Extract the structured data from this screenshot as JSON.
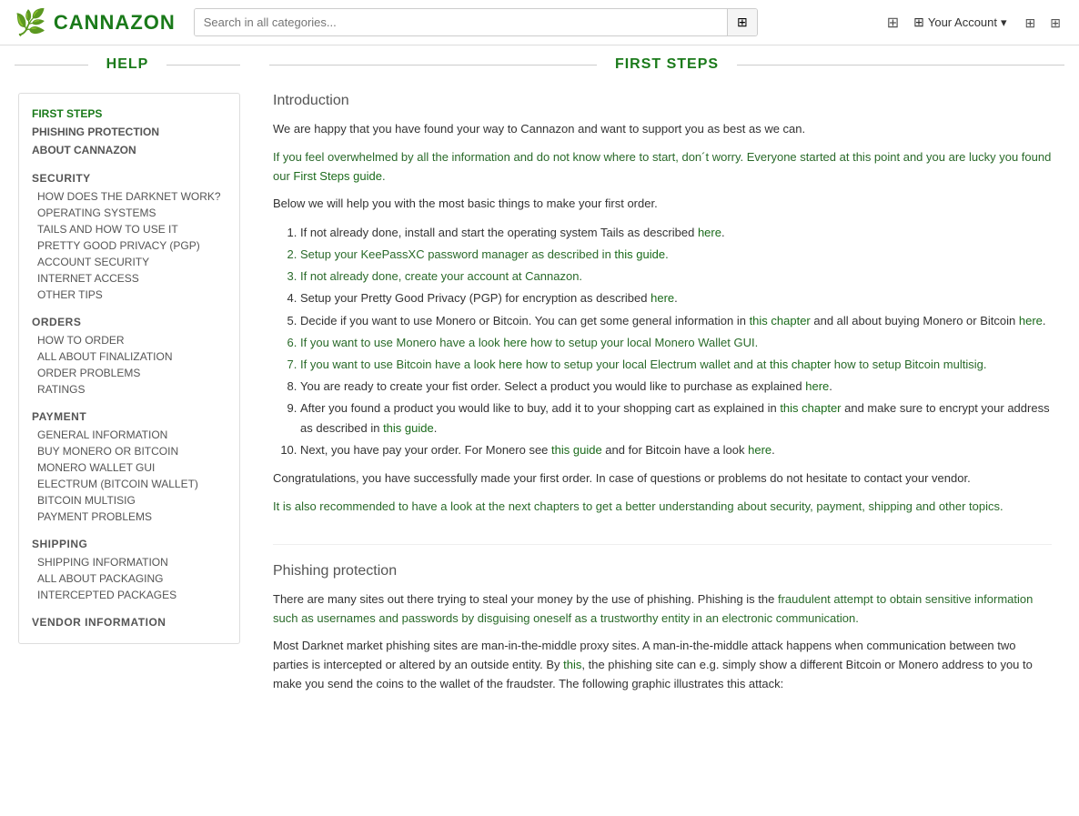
{
  "header": {
    "logo_text": "CANNAZON",
    "search_placeholder": "Search in all categories...",
    "account_label": "Your Account"
  },
  "help_section": {
    "title": "HELP"
  },
  "main_section": {
    "title": "FIRST STEPS"
  },
  "sidebar": {
    "top_items": [
      {
        "id": "first-steps",
        "label": "FIRST STEPS",
        "active": true
      },
      {
        "id": "phishing-protection",
        "label": "PHISHING PROTECTION",
        "active": false
      },
      {
        "id": "about-cannazon",
        "label": "ABOUT CANNAZON",
        "active": false
      }
    ],
    "sections": [
      {
        "label": "SECURITY",
        "items": [
          "HOW DOES THE DARKNET WORK?",
          "OPERATING SYSTEMS",
          "TAILS AND HOW TO USE IT",
          "PRETTY GOOD PRIVACY (PGP)",
          "ACCOUNT SECURITY",
          "INTERNET ACCESS",
          "OTHER TIPS"
        ]
      },
      {
        "label": "ORDERS",
        "items": [
          "HOW TO ORDER",
          "ALL ABOUT FINALIZATION",
          "ORDER PROBLEMS",
          "RATINGS"
        ]
      },
      {
        "label": "PAYMENT",
        "items": [
          "GENERAL INFORMATION",
          "BUY MONERO OR BITCOIN",
          "MONERO WALLET GUI",
          "ELECTRUM (BITCOIN WALLET)",
          "BITCOIN MULTISIG",
          "PAYMENT PROBLEMS"
        ]
      },
      {
        "label": "SHIPPING",
        "items": [
          "SHIPPING INFORMATION",
          "ALL ABOUT PACKAGING",
          "INTERCEPTED PACKAGES"
        ]
      },
      {
        "label": "VENDOR INFORMATION",
        "items": []
      }
    ]
  },
  "main_content": {
    "intro_heading": "Introduction",
    "intro_para1": "We are happy that you have found your way to Cannazon and want to support you as best as we can.",
    "intro_para2_pre": "If you feel overwhelmed by all the information and do not know where to start, don´t worry. Everyone started at this point and you are lucky you found our ",
    "intro_para2_link": "First Steps guide",
    "intro_para2_post": ".",
    "intro_para3": "Below we will help you with the most basic things to make your first order.",
    "steps": [
      {
        "text_pre": "If not already done, install and start the operating system Tails as described ",
        "link_text": "here",
        "text_post": ".",
        "green": false
      },
      {
        "text_pre": "Setup your KeePassXC password manager as described in ",
        "link_text": "this guide",
        "text_post": ".",
        "green": true
      },
      {
        "text_pre": "If not already done, create your account at Cannazon.",
        "link_text": "",
        "text_post": "",
        "green": true
      },
      {
        "text_pre": "Setup your Pretty Good Privacy (PGP) for encryption as described ",
        "link_text": "here",
        "text_post": ".",
        "green": false
      },
      {
        "text_pre": "Decide if you want to use Monero or Bitcoin. You can get some general information in ",
        "link_text": "this chapter",
        "text_post_pre": " and all about buying Monero or Bitcoin ",
        "link_text2": "here",
        "text_post": ".",
        "green": false
      },
      {
        "text_pre": "If you want to use Monero have a look ",
        "link_text": "here",
        "text_post": " how to setup your local Monero Wallet GUI.",
        "green": true
      },
      {
        "text_pre": "If you want to use Bitcoin have a look ",
        "link_text": "here",
        "text_post_pre": " how to setup your local Electrum wallet and at ",
        "link_text2": "this chapter",
        "text_post": " how to setup Bitcoin multisig.",
        "green": true
      },
      {
        "text_pre": "You are ready to create your fist order. Select a product you would like to purchase as explained ",
        "link_text": "here",
        "text_post": ".",
        "green": false
      },
      {
        "text_pre": "After you found a product you would like to buy, add it to your shopping cart as explained in ",
        "link_text": "this chapter",
        "text_post_pre": " and make sure to encrypt your address as described in ",
        "link_text2": "this guide",
        "text_post": ".",
        "green": false
      },
      {
        "text_pre": "Next, you have pay your order. For Monero see ",
        "link_text": "this guide",
        "text_post_pre": " and for Bitcoin have a look ",
        "link_text2": "here",
        "text_post": ".",
        "green": false
      }
    ],
    "congrats_para": "Congratulations, you have successfully made your first order. In case of questions or problems do not hesitate to contact your vendor.",
    "recommend_para": "It is also recommended to have a look at the next chapters to get a better understanding about security, payment, shipping and other topics.",
    "phishing_heading": "Phishing protection",
    "phishing_para1": "There are many sites out there trying to steal your money by the use of phishing. Phishing is the fraudulent attempt to obtain sensitive information such as usernames and passwords by disguising oneself as a trustworthy entity in an electronic communication.",
    "phishing_para2": "Most Darknet market phishing sites are man-in-the-middle proxy sites. A man-in-the-middle attack happens when communication between two parties is intercepted or altered by an outside entity. By this, the phishing site can e.g. simply show a different Bitcoin or Monero address to you to make you send the coins to the wallet of the fraudster. The following graphic illustrates this attack:"
  }
}
